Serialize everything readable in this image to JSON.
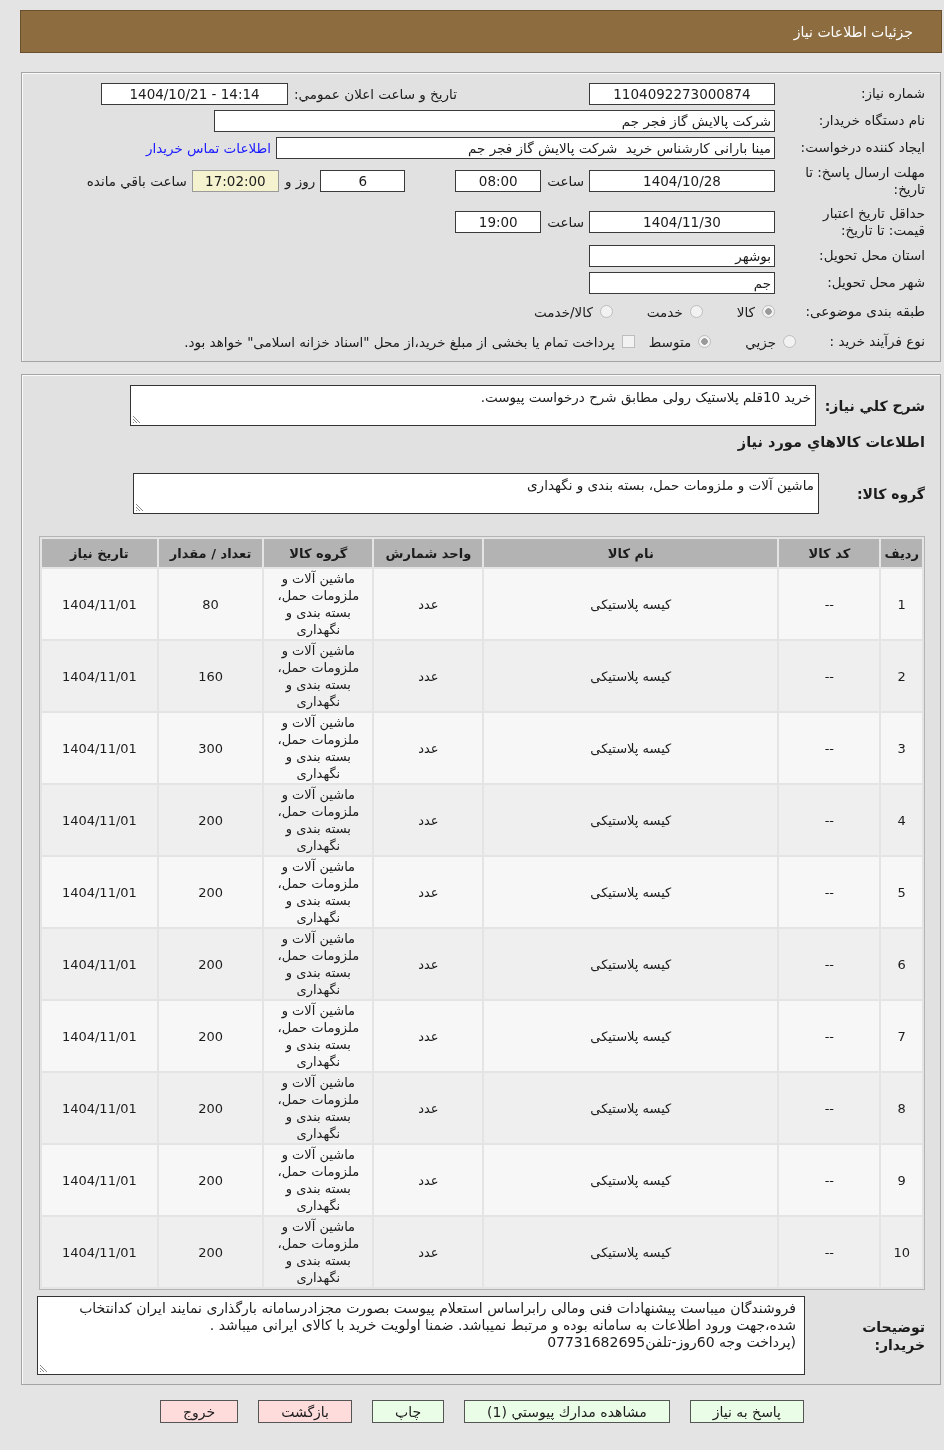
{
  "header": {
    "title": "جزئیات اطلاعات نیاز"
  },
  "need_info": {
    "need_number": {
      "label": "شماره نیاز:",
      "value": "1104092273000874"
    },
    "announce": {
      "label": "تاریخ و ساعت اعلان عمومي:",
      "value": "1404/10/21 - 14:14"
    },
    "buyer_org": {
      "label": "نام دستگاه خریدار:",
      "value": "شرکت پالایش گاز فجر جم"
    },
    "requester": {
      "label": "ایجاد کننده درخواست:",
      "value": "مینا بارانی کارشناس خرید  شرکت پالایش گاز فجر جم",
      "link": "اطلاعات تماس خریدار"
    },
    "response_deadline": {
      "label": "مهلت ارسال پاسخ: تا تاریخ:",
      "date": "1404/10/28",
      "time_label": "ساعت",
      "time": "08:00",
      "days": "6",
      "days_label": "روز و",
      "remaining": "17:02:00",
      "remaining_label": "ساعت باقي مانده"
    },
    "price_validity": {
      "label": "حداقل تاریخ اعتبار قیمت: تا تاریخ:",
      "date": "1404/11/30",
      "time_label": "ساعت",
      "time": "19:00"
    },
    "province": {
      "label": "استان محل تحویل:",
      "value": "بوشهر"
    },
    "city": {
      "label": "شهر محل تحویل:",
      "value": "جم"
    },
    "category": {
      "label": "طبقه بندی موضوعی:",
      "options": [
        {
          "label": "کالا",
          "selected": true
        },
        {
          "label": "خدمت",
          "selected": false
        },
        {
          "label": "کالا/خدمت",
          "selected": false
        }
      ]
    },
    "process": {
      "label": "نوع فرآیند خرید :",
      "options": [
        {
          "label": "جزيي",
          "selected": false
        },
        {
          "label": "متوسط",
          "selected": true
        }
      ],
      "treasury": {
        "label": "پرداخت تمام یا بخشی از مبلغ خرید،از محل \"اسناد خزانه اسلامی\" خواهد بود.",
        "checked": false
      }
    }
  },
  "details": {
    "summary": {
      "label": "شرح کلي نیاز:",
      "value": "خرید 10قلم پلاستیک رولی مطابق شرح درخواست پیوست."
    },
    "goods_heading": "اطلاعات کالاهاي مورد نیاز",
    "goods_group": {
      "label": "گروه کالا:",
      "value": "ماشین آلات و ملزومات حمل، بسته بندی و نگهداری"
    },
    "table": {
      "columns": [
        "ردیف",
        "کد کالا",
        "نام کالا",
        "واحد شمارش",
        "گروه کالا",
        "تعداد / مقدار",
        "تاریخ نیاز"
      ],
      "rows": [
        [
          "1",
          "--",
          "کیسه پلاستیکی",
          "عدد",
          "ماشین آلات و ملزومات حمل، بسته بندی و نگهداری",
          "80",
          "1404/11/01"
        ],
        [
          "2",
          "--",
          "کیسه پلاستیکی",
          "عدد",
          "ماشین آلات و ملزومات حمل، بسته بندی و نگهداری",
          "160",
          "1404/11/01"
        ],
        [
          "3",
          "--",
          "کیسه پلاستیکی",
          "عدد",
          "ماشین آلات و ملزومات حمل، بسته بندی و نگهداری",
          "300",
          "1404/11/01"
        ],
        [
          "4",
          "--",
          "کیسه پلاستیکی",
          "عدد",
          "ماشین آلات و ملزومات حمل، بسته بندی و نگهداری",
          "200",
          "1404/11/01"
        ],
        [
          "5",
          "--",
          "کیسه پلاستیکی",
          "عدد",
          "ماشین آلات و ملزومات حمل، بسته بندی و نگهداری",
          "200",
          "1404/11/01"
        ],
        [
          "6",
          "--",
          "کیسه پلاستیکی",
          "عدد",
          "ماشین آلات و ملزومات حمل، بسته بندی و نگهداری",
          "200",
          "1404/11/01"
        ],
        [
          "7",
          "--",
          "کیسه پلاستیکی",
          "عدد",
          "ماشین آلات و ملزومات حمل، بسته بندی و نگهداری",
          "200",
          "1404/11/01"
        ],
        [
          "8",
          "--",
          "کیسه پلاستیکی",
          "عدد",
          "ماشین آلات و ملزومات حمل، بسته بندی و نگهداری",
          "200",
          "1404/11/01"
        ],
        [
          "9",
          "--",
          "کیسه پلاستیکی",
          "عدد",
          "ماشین آلات و ملزومات حمل، بسته بندی و نگهداری",
          "200",
          "1404/11/01"
        ],
        [
          "10",
          "--",
          "کیسه پلاستیکی",
          "عدد",
          "ماشین آلات و ملزومات حمل، بسته بندی و نگهداری",
          "200",
          "1404/11/01"
        ]
      ]
    },
    "buyer_notes": {
      "label": "توضیحات خریدار:",
      "value": "فروشندگان میباست پیشنهادات فنی ومالی رابراساس استعلام پیوست بصورت مجزادرسامانه بارگذاری نمایند ایران کدانتخاب شده،جهت ورود اطلاعات به سامانه بوده و مرتبط نمیباشد. ضمنا اولویت خرید با کالای ایرانی میباشد .\n(پرداخت وجه 60روز-تلفن07731682695"
    }
  },
  "buttons": [
    {
      "label": "پاسخ به نیاز",
      "color": "#eafde6"
    },
    {
      "label": "مشاهده مدارك پيوستي (1)",
      "color": "#eafde6"
    },
    {
      "label": "چاپ",
      "color": "#eafde6"
    },
    {
      "label": "بازگشت",
      "color": "#ffdcdc"
    },
    {
      "label": "خروج",
      "color": "#ffdcdc"
    }
  ]
}
